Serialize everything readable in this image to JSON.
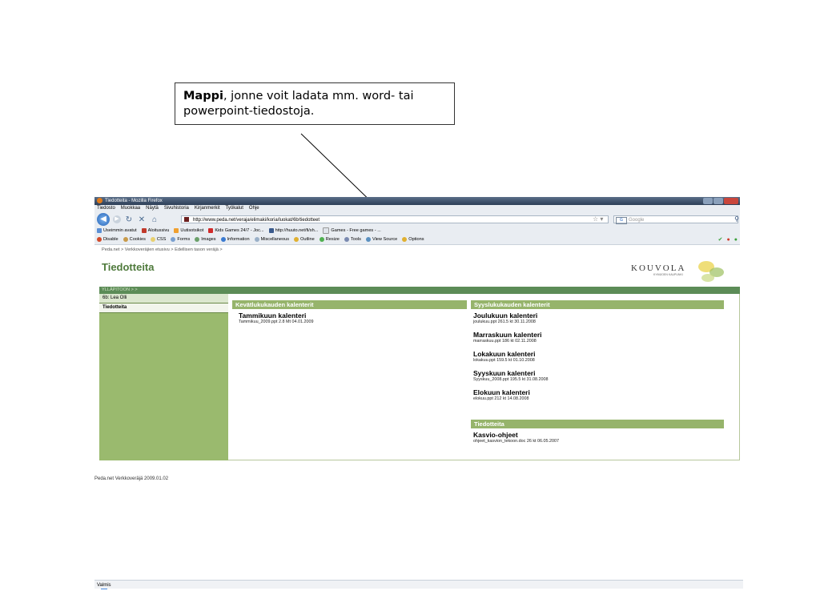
{
  "callout": {
    "bold": "Mappi",
    "text": ", jonne voit ladata mm. word- tai powerpoint-tiedostoja."
  },
  "browser": {
    "title": "Tiedotteita - Mozilla Firefox",
    "menu": [
      "Tiedosto",
      "Muokkaa",
      "Näytä",
      "Sivuhistoria",
      "Kirjanmerkit",
      "Työkalut",
      "Ohje"
    ],
    "url": "http://www.peda.net/veraja/elimaki/koria/luokat/6b/tiedotteet",
    "search_placeholder": "Google",
    "bookmarks": [
      "Useimmin avatut",
      "Aloitussivu",
      "Uutisotsikot",
      "Kids Games 24/7 - Joc...",
      "http://huuto.net/fi/sh...",
      "Games - Free games - ..."
    ],
    "devtools": [
      "Disable",
      "Cookies",
      "CSS",
      "Forms",
      "Images",
      "Information",
      "Miscellaneous",
      "Outline",
      "Resize",
      "Tools",
      "View Source",
      "Options"
    ]
  },
  "page": {
    "breadcrumb": "Peda.net > Verkkoveräjien etusivu > Edellisen tason veräjä >",
    "title": "Tiedotteita",
    "logo": {
      "word": "KOUVOLA",
      "sub": "KYMIJOEN KAUPUNKI"
    },
    "admin_bar": "YLLÄPITOON > >",
    "sidebar": [
      "6b: Lea Olli",
      "Tiedotteita"
    ],
    "left_section": {
      "header": "Kevätlukukauden kalenterit",
      "entries": [
        {
          "title": "Tammikuun kalenteri",
          "meta": "Tammikuu_2009.ppt 2.8 Mt 04.01.2009"
        }
      ]
    },
    "right_section": {
      "header": "Syyslukukauden kalenterit",
      "entries": [
        {
          "title": "Joulukuun kalenteri",
          "meta": "joulukuu.ppt 261.5 kt 30.11.2008"
        },
        {
          "title": "Marraskuun kalenteri",
          "meta": "marraskuu.ppt 186 kt 02.11.2008"
        },
        {
          "title": "Lokakuun kalenteri",
          "meta": "lokakuu.ppt 159.5 kt 01.10.2008"
        },
        {
          "title": "Syyskuun kalenteri",
          "meta": "Syyskuu_2008.ppt 195.5 kt 31.08.2008"
        },
        {
          "title": "Elokuun kalenteri",
          "meta": "elokuu.ppt 212 kt 14.08.2008"
        }
      ]
    },
    "notice_section": {
      "header": "Tiedotteita",
      "entries": [
        {
          "title": "Kasvio-ohjeet",
          "meta": "ohjeet_kasvion_tekoon.doc 26 kt 06.05.2007"
        }
      ]
    }
  },
  "footer": "Peda.net Verkkoveräjä 2009.01.02",
  "status": "Valmis"
}
